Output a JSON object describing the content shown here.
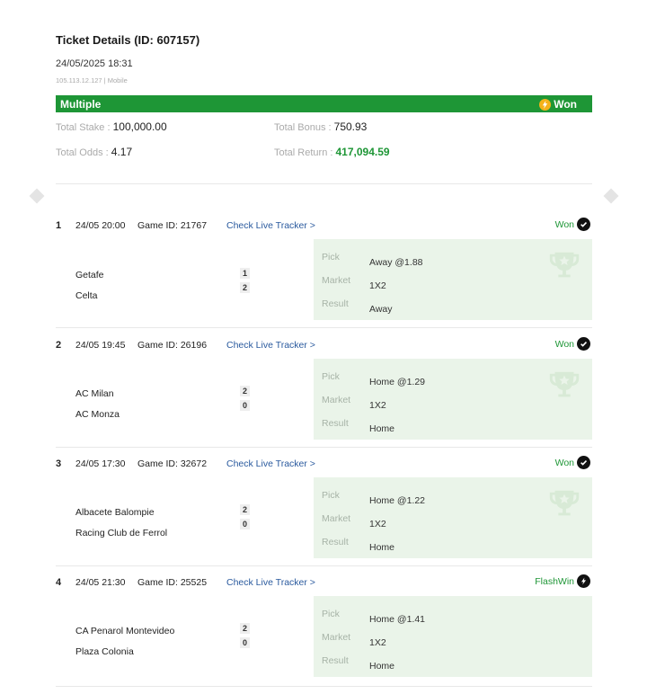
{
  "ticket": {
    "title": "Ticket Details (ID: 607157)",
    "datetime": "24/05/2025 18:31",
    "ip_device": "105.113.12.127 | Mobile",
    "bet_type": "Multiple",
    "status": "Won",
    "total_stake_label": "Total Stake : ",
    "total_stake": "100,000.00",
    "total_bonus_label": "Total Bonus : ",
    "total_bonus": "750.93",
    "total_odds_label": "Total Odds : ",
    "total_odds": "4.17",
    "total_return_label": "Total Return : ",
    "total_return": "417,094.59"
  },
  "labels": {
    "pick": "Pick",
    "market": "Market",
    "result": "Result"
  },
  "games": [
    {
      "num": "1",
      "time": "24/05 20:00",
      "game_id": "Game ID: 21767",
      "tracker": "Check Live Tracker >",
      "status": "Won",
      "home": "Getafe",
      "away": "Celta",
      "home_score": "1",
      "away_score": "2",
      "pick": "Away @1.88",
      "market": "1X2",
      "result": "Away"
    },
    {
      "num": "2",
      "time": "24/05 19:45",
      "game_id": "Game ID: 26196",
      "tracker": "Check Live Tracker >",
      "status": "Won",
      "home": "AC Milan",
      "away": "AC Monza",
      "home_score": "2",
      "away_score": "0",
      "pick": "Home @1.29",
      "market": "1X2",
      "result": "Home"
    },
    {
      "num": "3",
      "time": "24/05 17:30",
      "game_id": "Game ID: 32672",
      "tracker": "Check Live Tracker >",
      "status": "Won",
      "home": "Albacete Balompie",
      "away": "Racing Club de Ferrol",
      "home_score": "2",
      "away_score": "0",
      "pick": "Home @1.22",
      "market": "1X2",
      "result": "Home"
    },
    {
      "num": "4",
      "time": "24/05 21:30",
      "game_id": "Game ID: 25525",
      "tracker": "Check Live Tracker >",
      "status": "FlashWin",
      "home": "CA Penarol Montevideo",
      "away": "Plaza Colonia",
      "home_score": "2",
      "away_score": "0",
      "pick": "Home @1.41",
      "market": "1X2",
      "result": "Home"
    }
  ],
  "colors": {
    "brand_green": "#1e9636",
    "panel_bg": "#eaf4e9",
    "link": "#2a5a9e",
    "bolt": "#f4b21a"
  },
  "icons": {
    "won": "check-circle-icon",
    "flashwin": "lightning-circle-icon",
    "bet_won": "lightning-icon",
    "decor": "trophy-icon"
  }
}
